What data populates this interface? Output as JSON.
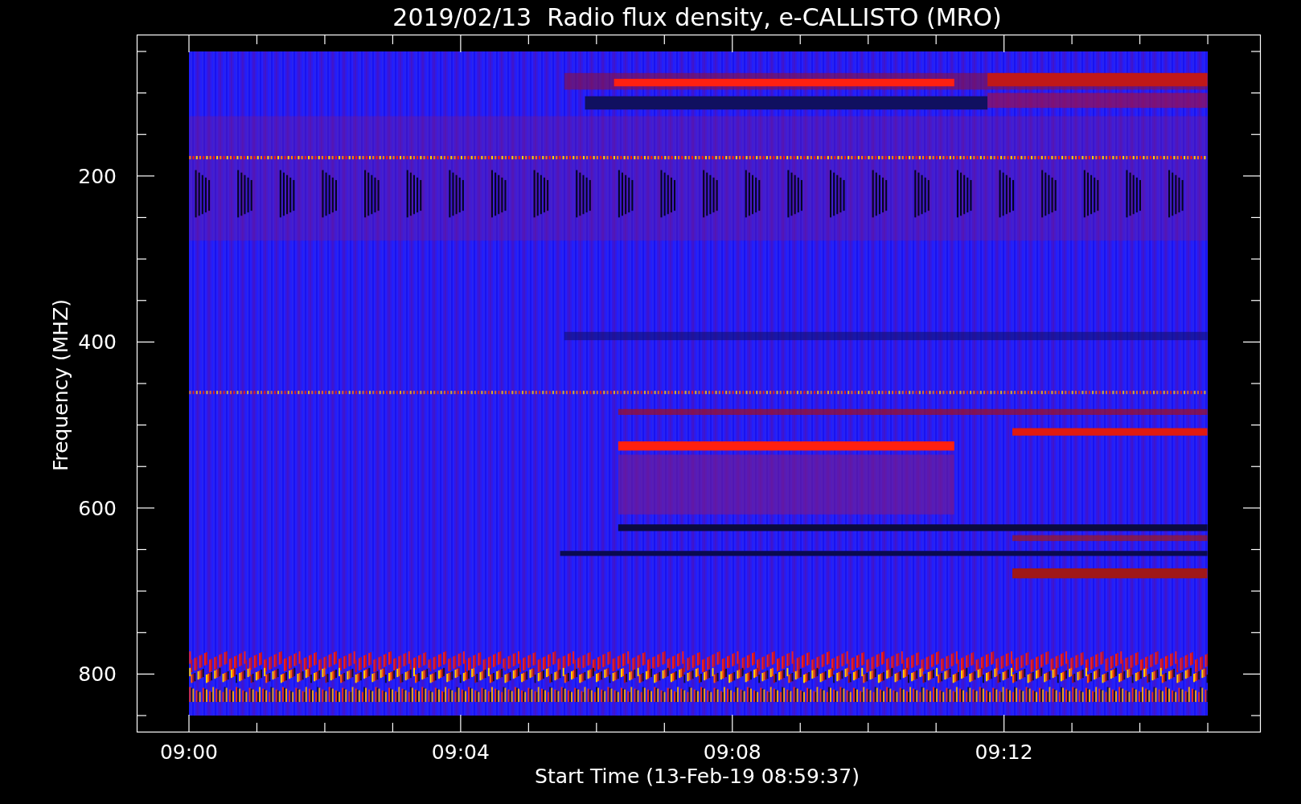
{
  "title": "2019/02/13  Radio flux density, e-CALLISTO (MRO)",
  "y_axis": {
    "label": "Frequency (MHZ)",
    "ticks": [
      "200",
      "400",
      "600",
      "800"
    ]
  },
  "x_axis": {
    "label": "Start Time (13-Feb-19 08:59:37)",
    "ticks": [
      "09:00",
      "09:04",
      "09:08",
      "09:12"
    ]
  }
}
